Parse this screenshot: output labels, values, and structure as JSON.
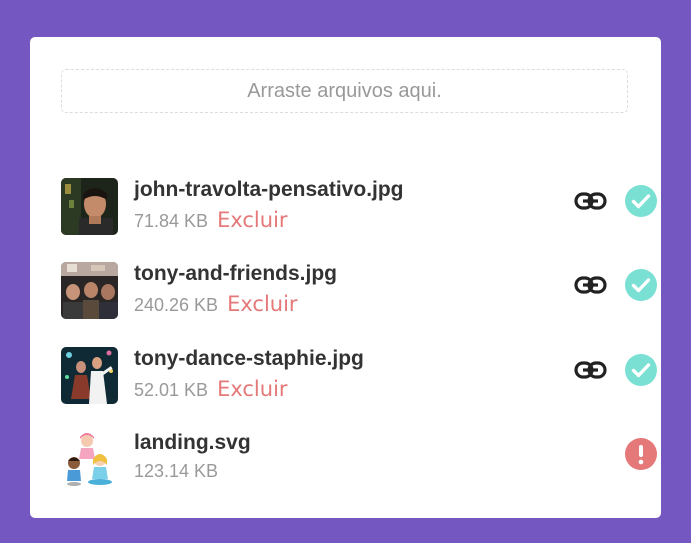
{
  "upload": {
    "dropzone_text": "Arraste arquivos aqui.",
    "delete_label": "Excluir",
    "colors": {
      "background": "#7457c1",
      "success": "#7ae0d4",
      "error": "#e57878",
      "delete_text": "#e57878"
    },
    "files": [
      {
        "name": "john-travolta-pensativo.jpg",
        "size": "71.84 KB",
        "status": "success",
        "has_link": true,
        "has_delete": true,
        "thumb_icon": "photo-thumbnail"
      },
      {
        "name": "tony-and-friends.jpg",
        "size": "240.26 KB",
        "status": "success",
        "has_link": true,
        "has_delete": true,
        "thumb_icon": "photo-thumbnail"
      },
      {
        "name": "tony-dance-staphie.jpg",
        "size": "52.01 KB",
        "status": "success",
        "has_link": true,
        "has_delete": true,
        "thumb_icon": "photo-thumbnail"
      },
      {
        "name": "landing.svg",
        "size": "123.14 KB",
        "status": "error",
        "has_link": false,
        "has_delete": false,
        "thumb_icon": "illustration-thumbnail"
      }
    ]
  }
}
